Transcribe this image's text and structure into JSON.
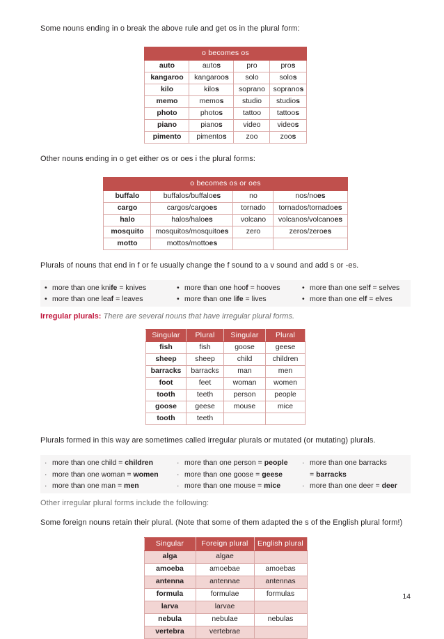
{
  "page": {
    "number": "14"
  },
  "intro1": "Some nouns ending in o break the above rule and get os in the plural form:",
  "intro2": "Other nouns ending in o get either os or oes i the plural forms:",
  "intro3": "Plurals of nouns that end in f or fe usually change the f sound to a v sound and add s or -es.",
  "intro4": "Plurals formed in this way are sometimes called irregular plurals or mutated (or mutating) plurals.",
  "intro5": "Other irregular plural forms include the following:",
  "intro6": "Some foreign nouns retain their plural. (Note that some of them adapted the s of the English plural form!)",
  "irregular": {
    "label": "Irregular plurals:",
    "description": "There are several nouns that have irregular plural forms."
  },
  "table_os": {
    "header": "o becomes os",
    "rows": [
      {
        "s1": "auto",
        "p1": "auto",
        "p1s": "s",
        "s2": "pro",
        "p2": "pro",
        "p2s": "s"
      },
      {
        "s1": "kangaroo",
        "p1": "kangaroo",
        "p1s": "s",
        "s2": "solo",
        "p2": "solo",
        "p2s": "s"
      },
      {
        "s1": "kilo",
        "p1": "kilo",
        "p1s": "s",
        "s2": "soprano",
        "p2": "soprano",
        "p2s": "s"
      },
      {
        "s1": "memo",
        "p1": "memo",
        "p1s": "s",
        "s2": "studio",
        "p2": "studio",
        "p2s": "s"
      },
      {
        "s1": "photo",
        "p1": "photo",
        "p1s": "s",
        "s2": "tattoo",
        "p2": "tattoo",
        "p2s": "s"
      },
      {
        "s1": "piano",
        "p1": "piano",
        "p1s": "s",
        "s2": "video",
        "p2": "video",
        "p2s": "s"
      },
      {
        "s1": "pimento",
        "p1": "pimento",
        "p1s": "s",
        "s2": "zoo",
        "p2": "zoo",
        "p2s": "s"
      }
    ]
  },
  "table_os_oes": {
    "header": "o becomes os or oes",
    "rows": [
      {
        "s1": "buffalo",
        "p1a": "buffalos/buffalo",
        "p1b": "es",
        "s2": "no",
        "p2a": "nos/no",
        "p2b": "es"
      },
      {
        "s1": "cargo",
        "p1a": "cargos/cargo",
        "p1b": "es",
        "s2": "tornado",
        "p2a": "tornados/tornado",
        "p2b": "es"
      },
      {
        "s1": "halo",
        "p1a": "halos/halo",
        "p1b": "es",
        "s2": "volcano",
        "p2a": "volcanos/volcano",
        "p2b": "es"
      },
      {
        "s1": "mosquito",
        "p1a": "mosquitos/mosquito",
        "p1b": "es",
        "s2": "zero",
        "p2a": "zeros/zero",
        "p2b": "es"
      },
      {
        "s1": "motto",
        "p1a": "mottos/motto",
        "p1b": "es",
        "s2": "",
        "p2a": "",
        "p2b": ""
      }
    ]
  },
  "f_fe_bullets": {
    "col1": [
      {
        "pre": "more than one kni",
        "bold": "fe",
        "post": " = knives"
      },
      {
        "pre": "more than one lea",
        "bold": "f",
        "post": " = leaves"
      }
    ],
    "col2": [
      {
        "pre": "more than one hoo",
        "bold": "f",
        "post": " = hooves"
      },
      {
        "pre": "more than one li",
        "bold": "fe",
        "post": " = lives"
      }
    ],
    "col3": [
      {
        "pre": "more than one sel",
        "bold": "f",
        "post": " = selves"
      },
      {
        "pre": "more than one el",
        "bold": "f",
        "post": " = elves"
      }
    ]
  },
  "table_irregular": {
    "headers": [
      "Singular",
      "Plural",
      "Singular",
      "Plural"
    ],
    "rows": [
      {
        "s1": "fish",
        "p1": "fish",
        "s2": "goose",
        "p2": "geese"
      },
      {
        "s1": "sheep",
        "p1": "sheep",
        "s2": "child",
        "p2": "children"
      },
      {
        "s1": "barracks",
        "p1": "barracks",
        "s2": "man",
        "p2": "men"
      },
      {
        "s1": "foot",
        "p1": "feet",
        "s2": "woman",
        "p2": "women"
      },
      {
        "s1": "tooth",
        "p1": "teeth",
        "s2": "person",
        "p2": "people"
      },
      {
        "s1": "goose",
        "p1": "geese",
        "s2": "mouse",
        "p2": "mice"
      },
      {
        "s1": "tooth",
        "p1": "teeth",
        "s2": "",
        "p2": ""
      }
    ]
  },
  "mutated_bullets": {
    "col1": [
      {
        "pre": "more than one child = ",
        "bold": "children"
      },
      {
        "pre": "more than one woman = ",
        "bold": "women"
      },
      {
        "pre": "more than one man = ",
        "bold": "men"
      }
    ],
    "col2": [
      {
        "pre": "more than one person = ",
        "bold": "people"
      },
      {
        "pre": "more than one goose = ",
        "bold": "geese"
      },
      {
        "pre": "more than one mouse = ",
        "bold": "mice"
      }
    ],
    "col3": [
      {
        "pre": "more than one barracks",
        "bold": ""
      },
      {
        "pre": "= ",
        "bold": "barracks",
        "indent": true
      },
      {
        "pre": "more than one deer = ",
        "bold": "deer"
      }
    ]
  },
  "table_foreign": {
    "headers": [
      "Singular",
      "Foreign plural",
      "English plural"
    ],
    "rows": [
      {
        "singular": "alga",
        "foreign": "algae",
        "english": "",
        "shade": true
      },
      {
        "singular": "amoeba",
        "foreign": "amoebae",
        "english": "amoebas",
        "shade": false
      },
      {
        "singular": "antenna",
        "foreign": "antennae",
        "english": "antennas",
        "shade": true
      },
      {
        "singular": "formula",
        "foreign": "formulae",
        "english": "formulas",
        "shade": false
      },
      {
        "singular": "larva",
        "foreign": "larvae",
        "english": "",
        "shade": true
      },
      {
        "singular": "nebula",
        "foreign": "nebulae",
        "english": "nebulas",
        "shade": false
      },
      {
        "singular": "vertebra",
        "foreign": "vertebrae",
        "english": "",
        "shade": true
      }
    ]
  },
  "colors": {
    "header_red": "#c0504d",
    "row_pink": "#f2d5d3",
    "border_pink": "#d9a8a6",
    "accent_crimson": "#c0153b"
  }
}
